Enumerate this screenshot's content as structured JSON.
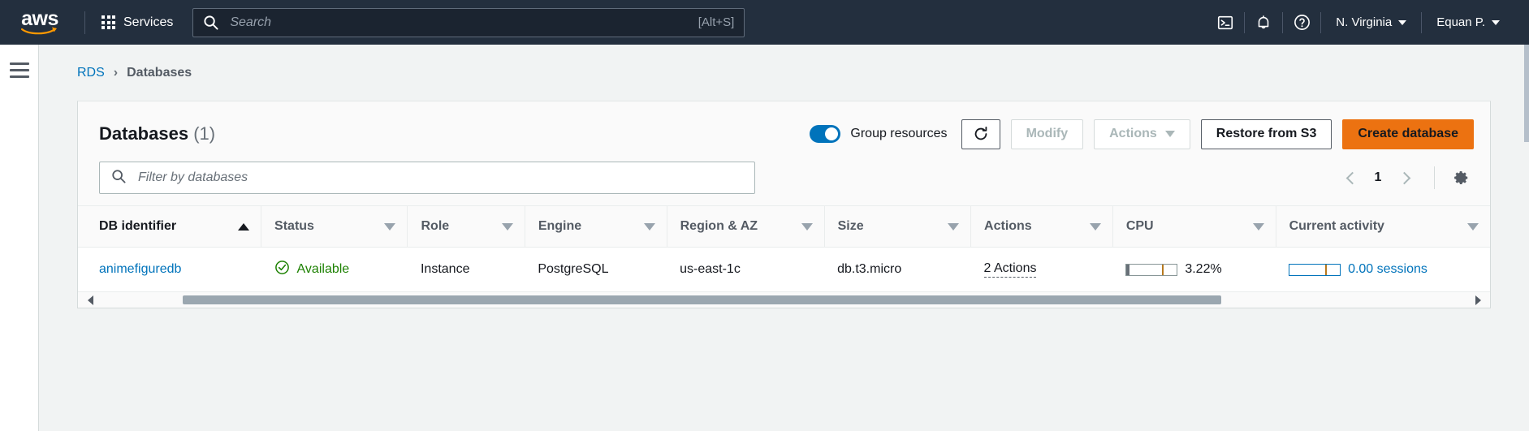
{
  "topnav": {
    "logo_alt": "aws",
    "services_label": "Services",
    "search_placeholder": "Search",
    "search_value": "",
    "search_shortcut": "[Alt+S]",
    "cloudshell_icon": "cloudshell-icon",
    "notifications_icon": "bell-icon",
    "help_icon": "help-icon",
    "region_label": "N. Virginia",
    "account_label": "Equan P."
  },
  "sidebar": {
    "menu_icon": "hamburger-menu-icon"
  },
  "breadcrumb": {
    "items": [
      {
        "label": "RDS",
        "link": true
      },
      {
        "label": "Databases",
        "link": false
      }
    ],
    "separator": "›"
  },
  "panel": {
    "title": "Databases",
    "count": "(1)",
    "group_resources_label": "Group resources",
    "group_resources_on": true,
    "refresh_icon": "refresh-icon",
    "modify_label": "Modify",
    "modify_disabled": true,
    "actions_label": "Actions",
    "actions_disabled": true,
    "restore_label": "Restore from S3",
    "create_label": "Create database"
  },
  "filter": {
    "placeholder": "Filter by databases",
    "value": "",
    "search_icon": "search-icon"
  },
  "pager": {
    "prev_icon": "chevron-left-icon",
    "page": "1",
    "next_icon": "chevron-right-icon",
    "settings_icon": "gear-icon"
  },
  "table": {
    "columns": [
      {
        "label": "DB identifier",
        "sort": "asc"
      },
      {
        "label": "Status",
        "sort": "none"
      },
      {
        "label": "Role",
        "sort": "none"
      },
      {
        "label": "Engine",
        "sort": "none"
      },
      {
        "label": "Region & AZ",
        "sort": "none"
      },
      {
        "label": "Size",
        "sort": "none"
      },
      {
        "label": "Actions",
        "sort": "none"
      },
      {
        "label": "CPU",
        "sort": "none"
      },
      {
        "label": "Current activity",
        "sort": "none"
      }
    ],
    "rows": [
      {
        "db_identifier": "animefiguredb",
        "status": "Available",
        "status_icon": "check-circle-icon",
        "role": "Instance",
        "engine": "PostgreSQL",
        "region_az": "us-east-1c",
        "size": "db.t3.micro",
        "actions": "2 Actions",
        "cpu": "3.22%",
        "cpu_pct": 3.22,
        "current_activity": "0.00 sessions",
        "sessions": 0.0
      }
    ]
  },
  "scrollbar": {
    "left_icon": "scroll-left-icon",
    "right_icon": "scroll-right-icon"
  },
  "colors": {
    "nav_bg": "#232f3e",
    "accent_orange": "#ec7211",
    "link_blue": "#0073bb",
    "status_green": "#1d8102"
  }
}
